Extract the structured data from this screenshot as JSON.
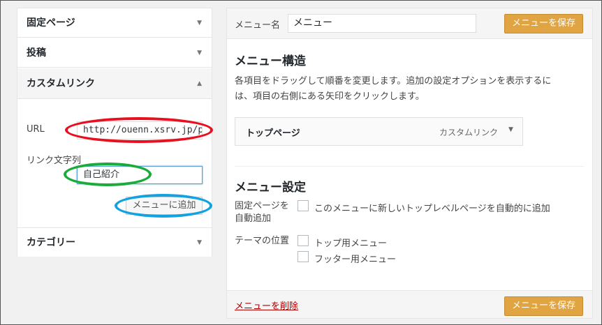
{
  "left_panel": {
    "sections": [
      {
        "label": "固定ページ",
        "arrow": "▼"
      },
      {
        "label": "投稿",
        "arrow": "▼"
      },
      {
        "label": "カスタムリンク",
        "arrow": "▲"
      },
      {
        "label": "カテゴリー",
        "arrow": "▼"
      }
    ],
    "custom_link": {
      "url_label": "URL",
      "url_value": "http://ouenn.xsrv.jp/p",
      "link_text_label": "リンク文字列",
      "link_text_value": "自己紹介",
      "add_button": "メニューに追加"
    }
  },
  "annotations": {
    "colors": {
      "url": "#e8101e",
      "link_text": "#1aab3b",
      "add_button": "#12a2e0"
    }
  },
  "menu_panel": {
    "name_label": "メニュー名",
    "name_value": "メニュー",
    "save_button": "メニューを保存",
    "structure_title": "メニュー構造",
    "structure_desc": "各項目をドラッグして順番を変更します。追加の設定オプションを表示するには、項目の右側にある矢印をクリックします。",
    "items": [
      {
        "title": "トップページ",
        "type": "カスタムリンク",
        "arrow": "▼"
      }
    ],
    "settings_title": "メニュー設定",
    "auto_add_label": "固定ページを自動追加",
    "auto_add_option": "このメニューに新しいトップレベルページを自動的に追加",
    "theme_location_label": "テーマの位置",
    "locations": [
      "トップ用メニュー",
      "フッター用メニュー"
    ],
    "delete_link": "メニューを削除",
    "save_button_bottom": "メニューを保存"
  },
  "colors": {
    "accent_button": "#e0a443",
    "delete_link": "#aa0000"
  }
}
